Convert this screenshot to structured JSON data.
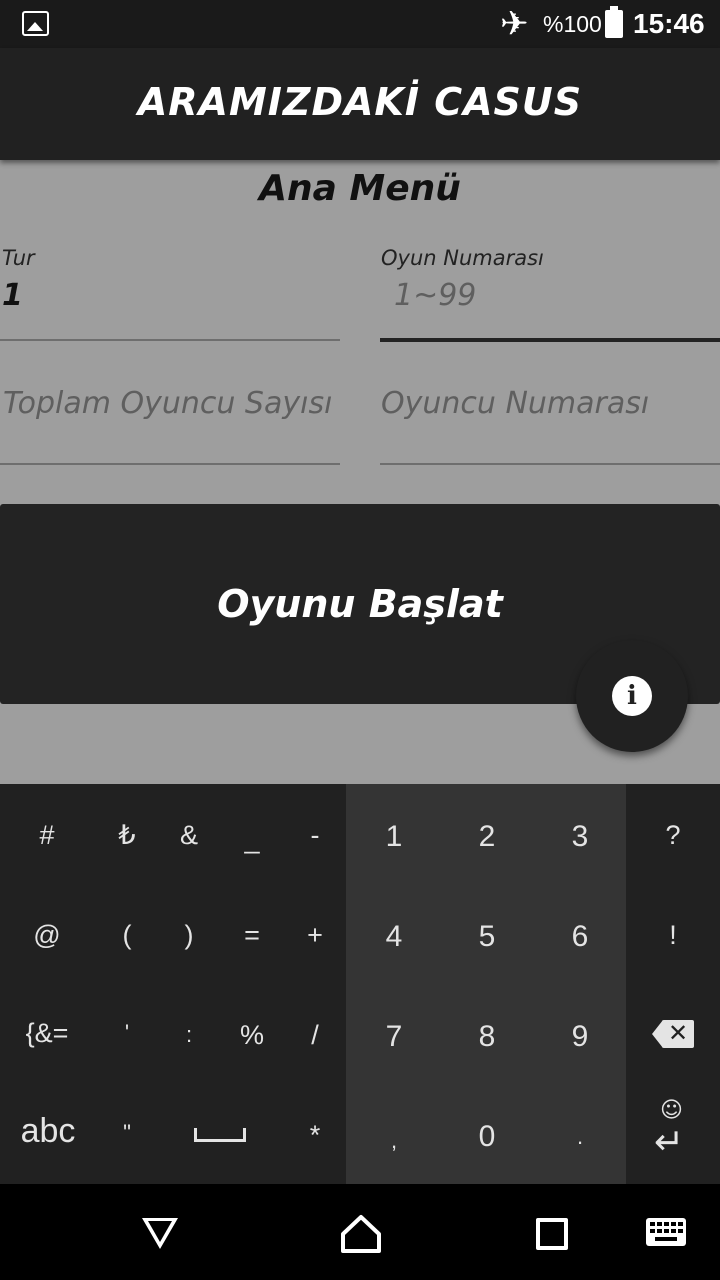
{
  "status_bar": {
    "battery": "%100",
    "time": "15:46",
    "icons": [
      "image-notification-icon",
      "airplane-mode-icon",
      "battery-icon"
    ]
  },
  "app_bar": {
    "title": "ARAMIZDAKİ CASUS"
  },
  "main": {
    "title": "Ana Menü",
    "fields": {
      "tur": {
        "label": "Tur",
        "value": "1"
      },
      "oyun_numarasi": {
        "label": "Oyun Numarası",
        "hint": "1~99"
      },
      "toplam_oyuncu": {
        "hint": "Toplam Oyuncu Sayısı"
      },
      "oyuncu_numarasi": {
        "hint": "Oyuncu Numarası"
      }
    },
    "start_button": "Oyunu Başlat",
    "fab_icon": "info-icon"
  },
  "keyboard": {
    "symbols": {
      "r1": [
        "#",
        "₺",
        "&",
        "_",
        "-"
      ],
      "r2": [
        "@",
        "(",
        ")",
        "=",
        "+"
      ],
      "r3": [
        "{&=",
        "'",
        ":",
        "%",
        "/"
      ],
      "r4": [
        "abc",
        "\"",
        "*"
      ]
    },
    "numbers": {
      "r1": [
        "1",
        "2",
        "3"
      ],
      "r2": [
        "4",
        "5",
        "6"
      ],
      "r3": [
        "7",
        "8",
        "9"
      ],
      "r4": [
        ",",
        "0",
        "."
      ]
    },
    "right": [
      "?",
      "!"
    ],
    "smiley": "☺",
    "enter": "↵"
  },
  "colors": {
    "app_bar": "#212121",
    "content_bg": "#9e9e9e",
    "keyboard_bg": "#212121",
    "keyboard_numpad_bg": "#343434"
  }
}
